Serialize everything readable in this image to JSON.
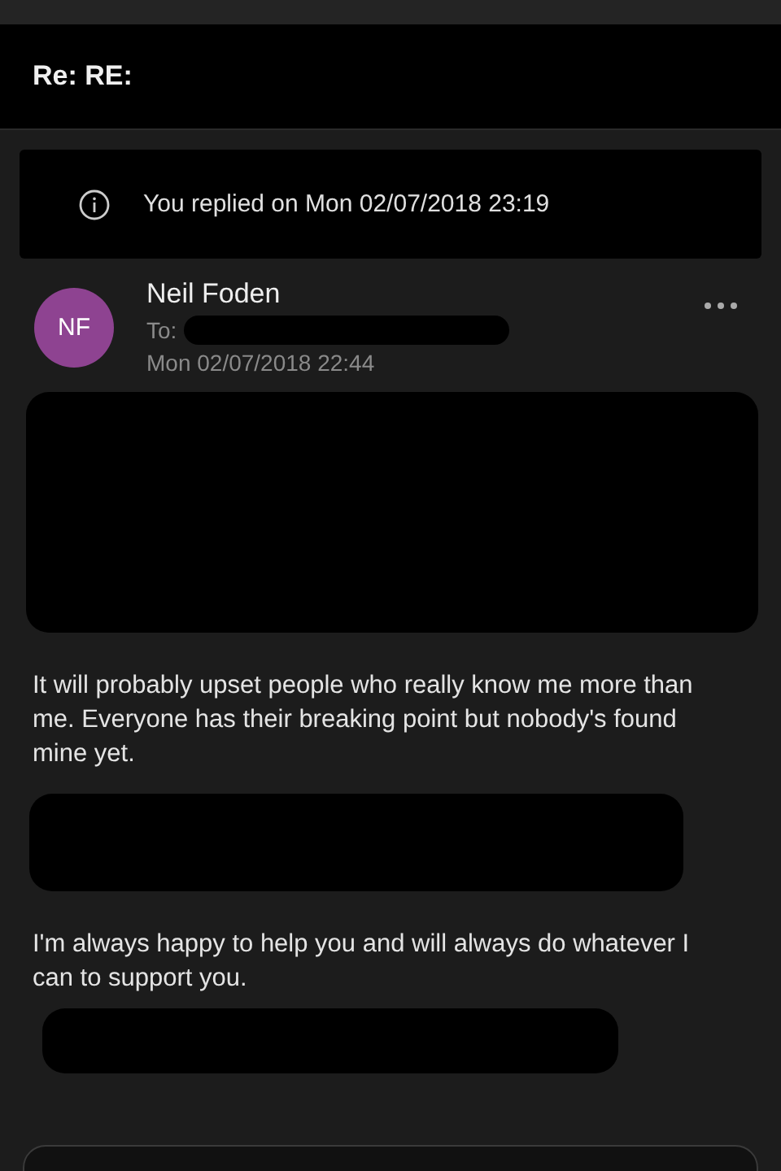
{
  "header": {
    "subject": "Re: RE:"
  },
  "notice": {
    "text": "You replied on Mon 02/07/2018 23:19"
  },
  "message": {
    "initials": "NF",
    "sender": "Neil Foden",
    "to_label": "To:",
    "date": "Mon 02/07/2018 22:44"
  },
  "body": [
    {
      "kind": "redaction"
    },
    {
      "kind": "text",
      "text": "It will probably upset people who really know me more than me. Everyone has their breaking point but nobody's found mine yet."
    },
    {
      "kind": "redaction"
    },
    {
      "kind": "text",
      "text": "I'm always happy to help you and will always do whatever I can to support you."
    },
    {
      "kind": "redaction"
    }
  ]
}
